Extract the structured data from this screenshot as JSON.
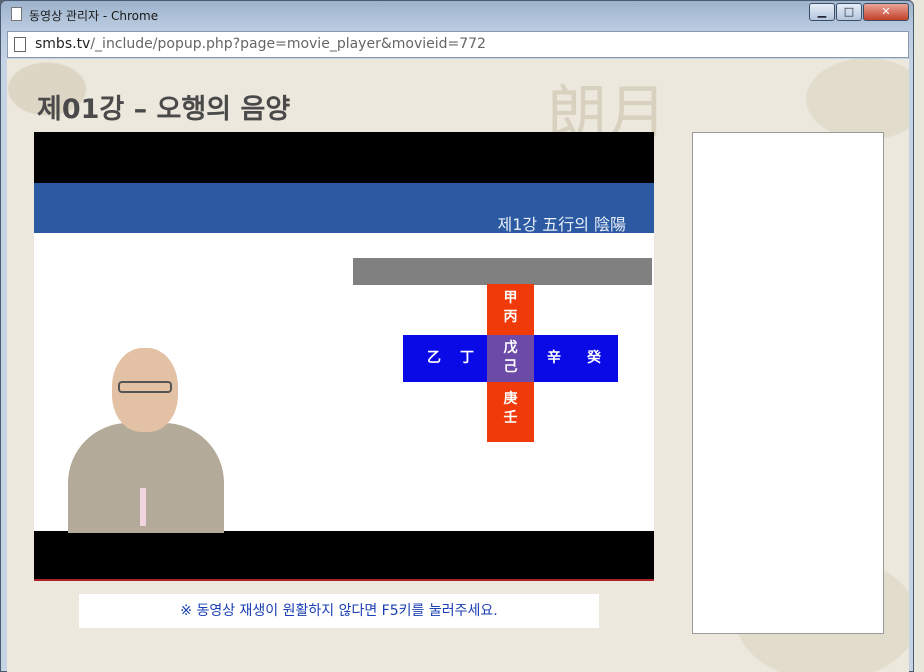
{
  "window": {
    "title": "동영상 관리자 - Chrome",
    "url_host": "smbs.tv",
    "url_path": "/_include/popup.php?page=movie_player&movieid=772"
  },
  "page": {
    "title": "제01강 – 오행의 음양",
    "notice": "※ 동영상 재생이 원활하지 않다면 F5키를 눌러주세요."
  },
  "video": {
    "slide_heading": "제1강 五行의 陰陽",
    "stems": {
      "top_1": "甲",
      "top_2": "丙",
      "left_1": "乙",
      "left_2": "丁",
      "center_1": "戊",
      "center_2": "己",
      "right_1": "辛",
      "right_2": "癸",
      "bottom_1": "庚",
      "bottom_2": "壬"
    },
    "colors": {
      "banner": "#2b5aa3",
      "vertical_arm": "#f03a0a",
      "horizontal_arm": "#0a0ae6",
      "center": "#6b4aa8"
    }
  }
}
